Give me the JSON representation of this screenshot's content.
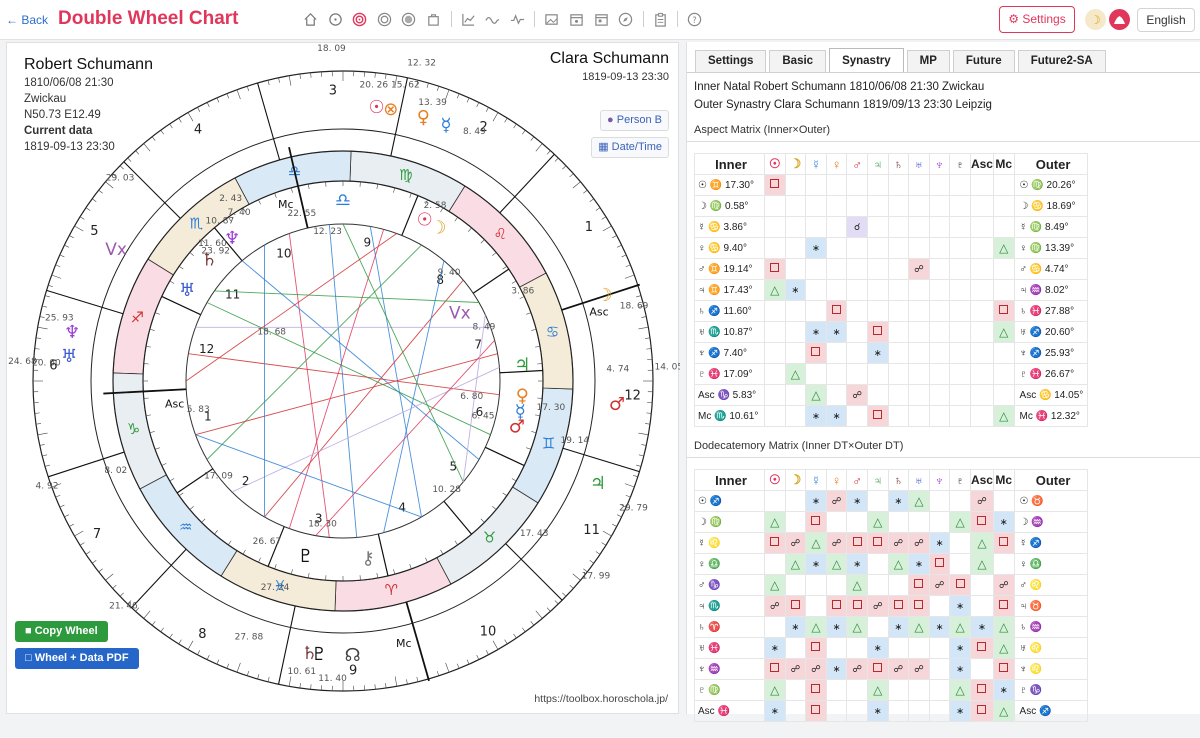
{
  "app": {
    "back": "Back",
    "title": "Double Wheel Chart",
    "settings": "Settings",
    "language": "English",
    "moon_icon": "☽",
    "theme_icon": "lotus-icon"
  },
  "colors": {
    "accent": "#e0365b",
    "link": "#2c6fcc",
    "aspect_square": "#f6d6d9",
    "aspect_trine": "#d7f0da",
    "aspect_sextile": "#d3e6f8",
    "aspect_opposition": "#f6d6d9",
    "aspect_conjunction": "#e3dcf5"
  },
  "toolbar_icons": [
    "house-icon",
    "circle-dot-icon",
    "target-icon",
    "target-alt-icon",
    "disc-icon",
    "bag-icon",
    "line-chart-icon",
    "wave-icon",
    "pulse-icon",
    "image-icon",
    "calendar-icon",
    "calendar-alt-icon",
    "compass-icon",
    "clipboard-icon",
    "help-icon"
  ],
  "personA": {
    "name": "Robert Schumann",
    "date": "1810/06/08 21:30",
    "place": "Zwickau",
    "coords": "N50.73 E12.49",
    "current_label": "Current data",
    "current": "1819-09-13 23:30"
  },
  "personB": {
    "name": "Clara Schumann",
    "date": "1819-09-13 23:30"
  },
  "buttons": {
    "person_b": "Person B",
    "datetime": "Date/Time",
    "copy_wheel": "Copy Wheel",
    "pdf": "Wheel + Data PDF"
  },
  "credit": "https://toolbox.horoschola.jp/",
  "wheel": {
    "outer_house_numbers": [
      "1",
      "2",
      "3",
      "4",
      "5",
      "6",
      "7",
      "8",
      "9",
      "10",
      "11",
      "12"
    ],
    "inner_house_numbers": [
      "1",
      "2",
      "3",
      "4",
      "5",
      "6",
      "7",
      "8",
      "9",
      "10",
      "11",
      "12"
    ],
    "outer_labels": [
      "Asc",
      "Mc",
      "Vx"
    ],
    "inner_labels": [
      "Asc",
      "Mc",
      "Vx"
    ],
    "degree_labels": [
      "18. 09",
      "12. 32",
      "14. 05",
      "17. 99",
      "29. 79",
      "4. 92",
      "24. 68",
      "21. 46",
      "17. 09",
      "26. 67",
      "27. 24",
      "27. 88",
      "11. 40",
      "10. 61",
      "2. 43",
      "23. 92",
      "18. 68",
      "20. 60",
      "25. 93",
      "20. 26",
      "15. 62",
      "13. 39",
      "8. 49",
      "4. 74",
      "19. 14",
      "17. 30",
      "17. 43",
      "8. 02",
      "22. 55",
      "12. 23",
      "10. 87",
      "7. 40",
      "11. 60",
      "8. 49",
      "9. 40",
      "18. 69",
      "29. 03",
      "2. 58",
      "3. 86",
      "6. 80",
      "5. 83",
      "6. 45",
      "10. 28",
      "18. 30"
    ]
  },
  "tabs": [
    "Settings",
    "Basic",
    "Synastry",
    "MP",
    "Future",
    "Future2-SA"
  ],
  "active_tab": "Synastry",
  "synastry": {
    "inner_line": "Inner Natal Robert Schumann 1810/06/08 21:30 Zwickau",
    "outer_line": "Outer Synastry Clara Schumann 1819/09/13 23:30 Leipzig",
    "aspect_title": "Aspect Matrix (Inner×Outer)",
    "dodec_title": "Dodecatemory Matrix (Inner DT×Outer DT)",
    "inner_header": "Inner",
    "outer_header": "Outer",
    "col_headers": [
      "☉",
      "☽",
      "☿",
      "♀",
      "♂",
      "♃",
      "♄",
      "♅",
      "♆",
      "♇",
      "Asc",
      "Mc"
    ],
    "aspect_rows": [
      {
        "inner": "☉ ♊ 17.30°",
        "outer": "☉ ♍ 20.26°",
        "cells": {
          "0": "sq"
        }
      },
      {
        "inner": "☽ ♍ 0.58°",
        "outer": "☽ ♋ 18.69°",
        "cells": {}
      },
      {
        "inner": "☿ ♋ 3.86°",
        "outer": "☿ ♍ 8.49°",
        "cells": {
          "4": "conj"
        }
      },
      {
        "inner": "♀ ♋ 9.40°",
        "outer": "♀ ♍ 13.39°",
        "cells": {
          "2": "sex",
          "11": "tri"
        }
      },
      {
        "inner": "♂ ♊ 19.14°",
        "outer": "♂ ♋ 4.74°",
        "cells": {
          "0": "sq",
          "7": "opp"
        }
      },
      {
        "inner": "♃ ♊ 17.43°",
        "outer": "♃ ♒ 8.02°",
        "cells": {
          "0": "tri",
          "1": "sex"
        }
      },
      {
        "inner": "♄ ♐ 11.60°",
        "outer": "♄ ♓ 27.88°",
        "cells": {
          "3": "sq",
          "11": "sq"
        }
      },
      {
        "inner": "♅ ♏ 10.87°",
        "outer": "♅ ♐ 20.60°",
        "cells": {
          "2": "sex",
          "3": "sex",
          "5": "sq",
          "11": "tri"
        }
      },
      {
        "inner": "♆ ♐ 7.40°",
        "outer": "♆ ♐ 25.93°",
        "cells": {
          "2": "sq",
          "5": "sex"
        }
      },
      {
        "inner": "♇ ♓ 17.09°",
        "outer": "♇ ♓ 26.67°",
        "cells": {
          "1": "tri"
        }
      },
      {
        "inner": "Asc ♑ 5.83°",
        "outer": "Asc ♋ 14.05°",
        "cells": {
          "2": "tri",
          "4": "opp"
        }
      },
      {
        "inner": "Mc ♏ 10.61°",
        "outer": "Mc ♓ 12.32°",
        "cells": {
          "2": "sex",
          "3": "sex",
          "5": "sq",
          "11": "tri"
        }
      }
    ],
    "dodec_rows": [
      {
        "inner": "☉ ♐",
        "outer": "☉ ♉",
        "cells": {
          "2": "sex",
          "3": "opp",
          "4": "sex",
          "6": "sex",
          "7": "tri",
          "10": "opp"
        }
      },
      {
        "inner": "☽ ♍",
        "outer": "☽ ♒",
        "cells": {
          "0": "tri",
          "2": "sq",
          "5": "tri",
          "9": "tri",
          "10": "sq",
          "11": "sex"
        }
      },
      {
        "inner": "☿ ♌",
        "outer": "☿ ♐",
        "cells": {
          "0": "sq",
          "1": "opp",
          "2": "tri",
          "3": "opp",
          "4": "sq",
          "5": "sq",
          "6": "opp",
          "7": "opp",
          "8": "sex",
          "10": "tri",
          "11": "sq"
        }
      },
      {
        "inner": "♀ ♎",
        "outer": "♀ ♎",
        "cells": {
          "1": "tri",
          "2": "sex",
          "3": "tri",
          "4": "sex",
          "6": "tri",
          "7": "sex",
          "8": "sq",
          "10": "tri"
        }
      },
      {
        "inner": "♂ ♑",
        "outer": "♂ ♌",
        "cells": {
          "0": "tri",
          "4": "tri",
          "7": "sq",
          "8": "opp",
          "9": "sq",
          "11": "opp"
        }
      },
      {
        "inner": "♃ ♏",
        "outer": "♃ ♉",
        "cells": {
          "0": "opp",
          "1": "sq",
          "3": "sq",
          "4": "sq",
          "5": "opp",
          "6": "sq",
          "7": "sq",
          "9": "sex",
          "11": "sq"
        }
      },
      {
        "inner": "♄ ♈",
        "outer": "♄ ♒",
        "cells": {
          "1": "sex",
          "2": "tri",
          "3": "sex",
          "4": "tri",
          "6": "sex",
          "7": "tri",
          "8": "sex",
          "9": "tri",
          "10": "sex",
          "11": "tri"
        }
      },
      {
        "inner": "♅ ♓",
        "outer": "♅ ♌",
        "cells": {
          "0": "sex",
          "2": "sq",
          "5": "sex",
          "9": "sex",
          "10": "sq",
          "11": "tri"
        }
      },
      {
        "inner": "♆ ♒",
        "outer": "♆ ♌",
        "cells": {
          "0": "sq",
          "1": "opp",
          "2": "opp",
          "3": "sex",
          "4": "opp",
          "5": "sq",
          "6": "opp",
          "7": "opp",
          "9": "sex",
          "11": "sq"
        }
      },
      {
        "inner": "♇ ♍",
        "outer": "♇ ♑",
        "cells": {
          "0": "tri",
          "2": "sq",
          "5": "tri",
          "9": "tri",
          "10": "sq",
          "11": "sex"
        }
      },
      {
        "inner": "Asc ♓",
        "outer": "Asc ♐",
        "cells": {
          "0": "sex",
          "2": "sq",
          "5": "sex",
          "9": "sex",
          "10": "sq",
          "11": "tri"
        }
      }
    ]
  }
}
